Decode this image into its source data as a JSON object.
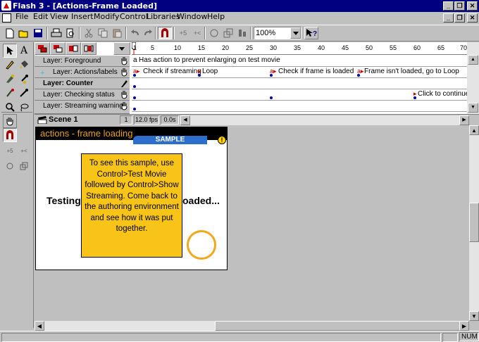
{
  "window": {
    "title": "Flash 3 - [Actions-Frame Loaded]"
  },
  "menu": {
    "items": [
      "File",
      "Edit",
      "View",
      "Insert",
      "Modify",
      "Control",
      "Libraries",
      "Window",
      "Help"
    ]
  },
  "toolbar": {
    "zoom": "100%"
  },
  "timeline": {
    "ruler": [
      "1",
      "5",
      "10",
      "15",
      "20",
      "25",
      "30",
      "35",
      "40",
      "45",
      "50",
      "55",
      "60",
      "65",
      "70"
    ],
    "layers": [
      {
        "name": "Layer: Foreground",
        "frame_label": "Has action to prevent enlarging on test movie"
      },
      {
        "name": "Layer: Actions/labels",
        "labels": [
          "Check if streaming",
          "Loop",
          "Check if frame is loaded",
          "Frame isn't loaded, go to Loop"
        ]
      },
      {
        "name": "Layer: Counter"
      },
      {
        "name": "Layer: Checking status",
        "frame_label": "Click to continue"
      },
      {
        "name": "Layer: Streaming warning"
      }
    ],
    "scene": "Scene 1",
    "frame": "1",
    "fps": "12.0 fps",
    "time": "0.0s"
  },
  "movie": {
    "header": "actions - frame loading",
    "sample_tab": "SAMPLE",
    "sample_info": "!",
    "note": "To see this sample, use Control>Test Movie followed by Control>Show Streaming. Come back to the authoring environment and see how it was put together.",
    "left_text": "Testing",
    "right_text": "oaded..."
  },
  "status": {
    "num": "NUM"
  }
}
